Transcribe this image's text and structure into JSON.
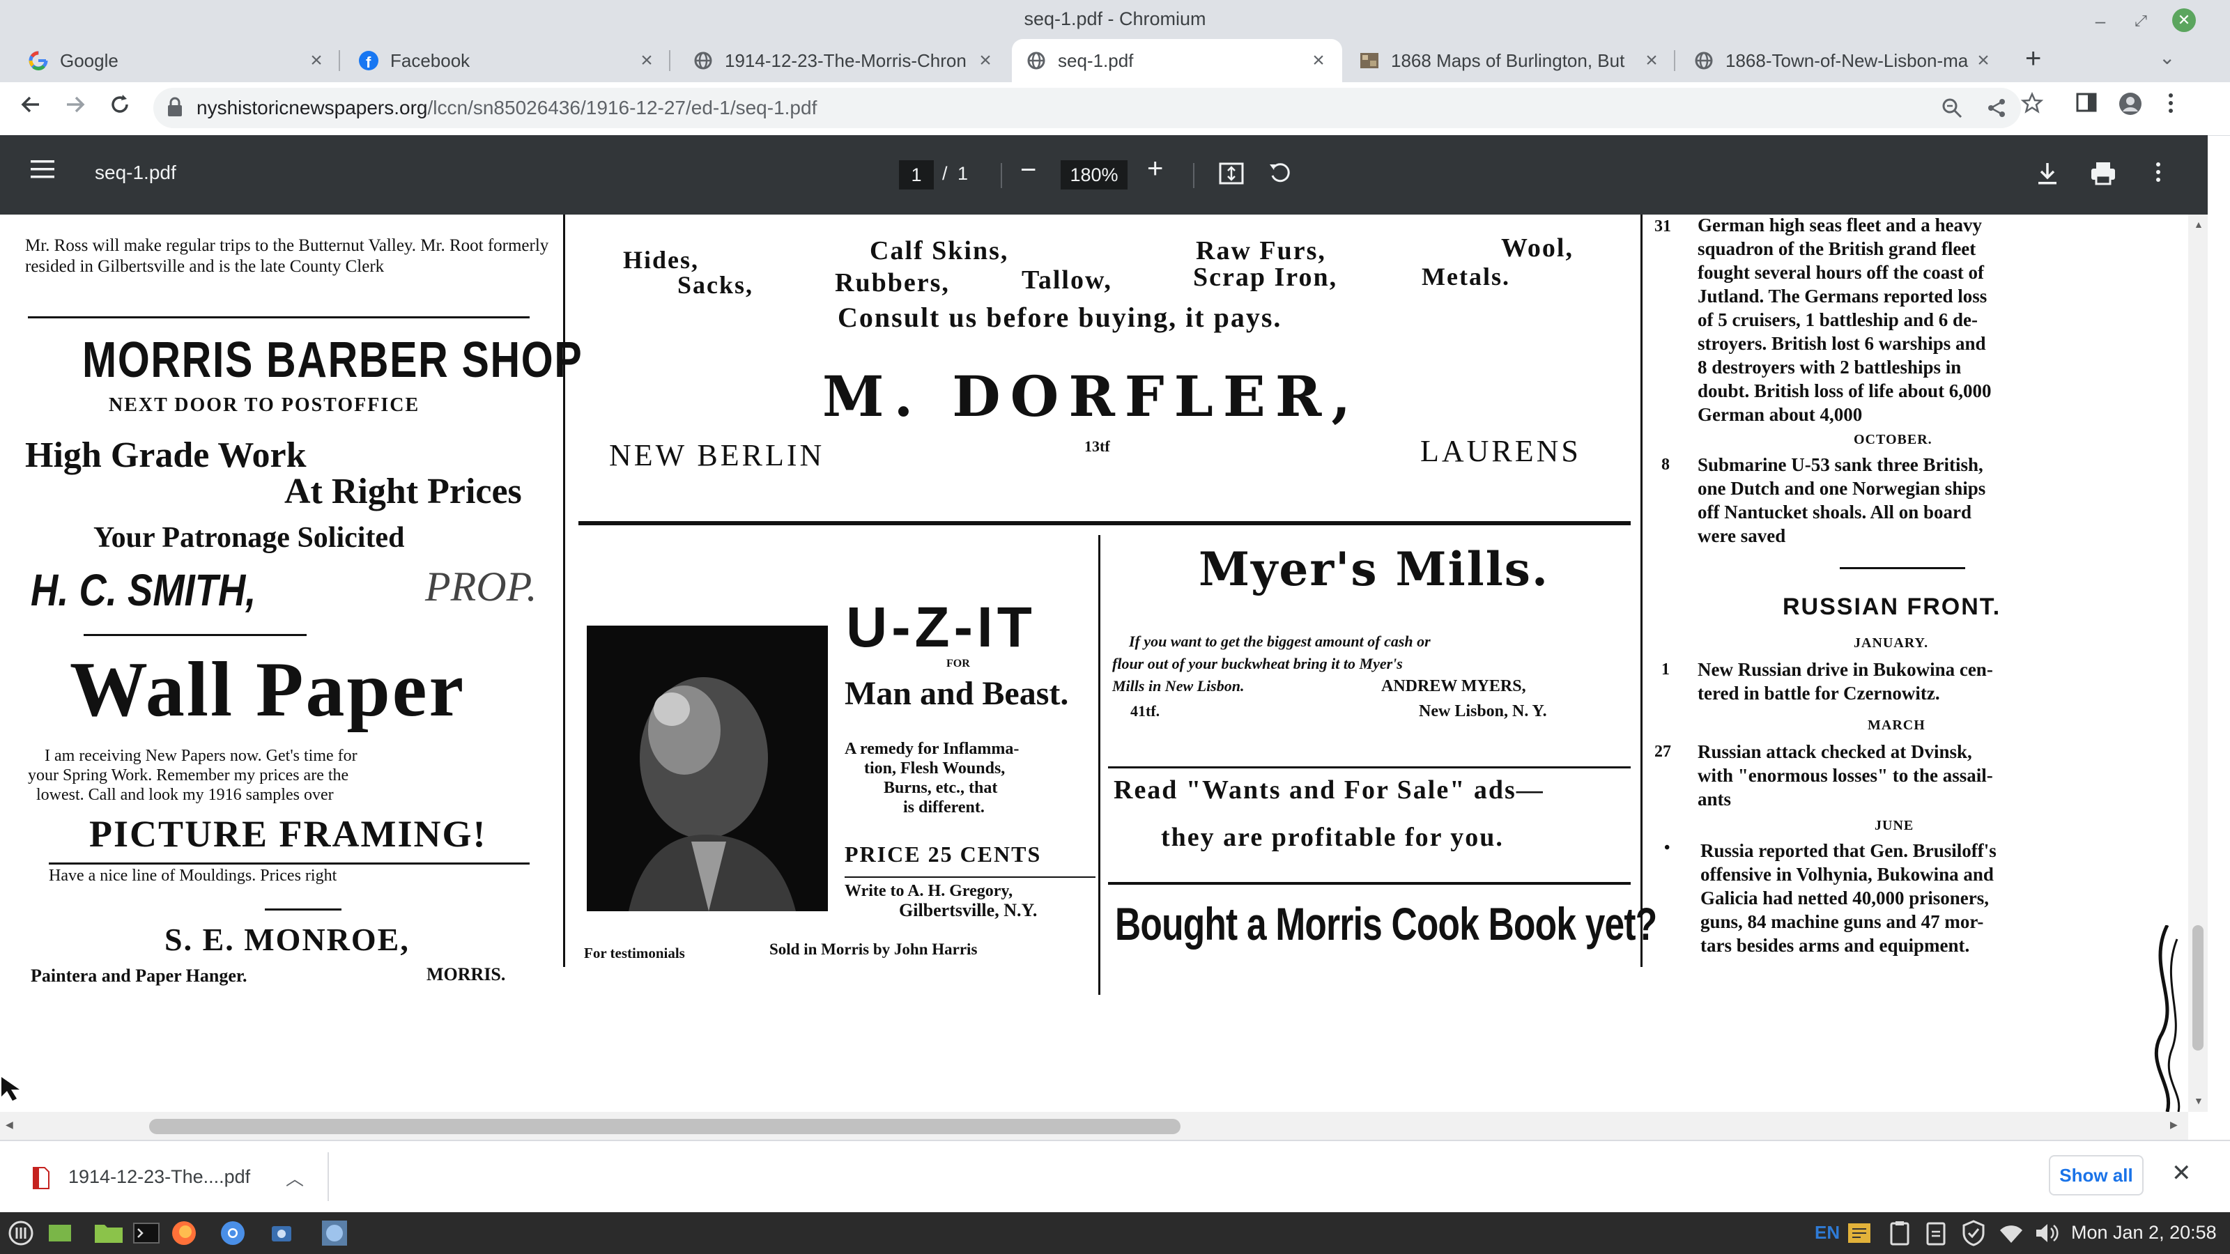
{
  "window": {
    "title": "seq-1.pdf - Chromium"
  },
  "tabs": [
    {
      "label": "Google",
      "icon": "google-icon",
      "active": false
    },
    {
      "label": "Facebook",
      "icon": "facebook-icon",
      "active": false
    },
    {
      "label": "1914-12-23-The-Morris-Chron",
      "icon": "globe-icon",
      "active": false
    },
    {
      "label": "seq-1.pdf",
      "icon": "globe-icon",
      "active": true
    },
    {
      "label": "1868 Maps of Burlington, But",
      "icon": "map-icon",
      "active": false
    },
    {
      "label": "1868-Town-of-New-Lisbon-ma",
      "icon": "globe-icon",
      "active": false
    }
  ],
  "omnibox": {
    "domain": "nyshistoricnewspapers.org",
    "path": "/lccn/sn85026436/1916-12-27/ed-1/seq-1.pdf"
  },
  "pdf_toolbar": {
    "title": "seq-1.pdf",
    "current_page": "1",
    "page_separator": "/",
    "total_pages": "1",
    "zoom": "180%",
    "zoom_out": "−",
    "zoom_in": "+"
  },
  "newspaper": {
    "col1": {
      "top_fragment": "Mr. Ross will make regular trips to the Butternut Valley. Mr. Root formerly resided in Gilbertsville and is the late County Clerk",
      "barber_title": "MORRIS BARBER SHOP",
      "barber_sub": "NEXT DOOR TO POSTOFFICE",
      "barber_l1": "High Grade Work",
      "barber_l2": "At Right Prices",
      "barber_l3": "Your Patronage Solicited",
      "barber_name": "H. C. SMITH,",
      "barber_prop": "PROP.",
      "wall_title": "Wall Paper",
      "wall_body_1": "I am receiving New Papers now. Get's time for",
      "wall_body_2": "your Spring Work. Remember my prices are the",
      "wall_body_3": "lowest. Call and look my 1916 samples over",
      "framing": "PICTURE FRAMING!",
      "framing_sub": "Have a nice line of Mouldings.     Prices right",
      "monroe": "S. E. MONROE,",
      "monroe_sub": "Paintera and Paper Hanger.",
      "monroe_town": "MORRIS."
    },
    "dorfler": {
      "row1": [
        "Hides,",
        "Calf Skins,",
        "Raw Furs,",
        "Wool,"
      ],
      "row2": [
        "Sacks,",
        "Rubbers,",
        "Tallow,",
        "Scrap Iron,",
        "Metals."
      ],
      "consult": "Consult us before buying, it pays.",
      "name": "M. DORFLER,",
      "left_town": "NEW BERLIN",
      "right_town": "LAURENS",
      "mid": "13tf"
    },
    "uzit": {
      "title": "U-Z-IT",
      "for": "FOR",
      "sub": "Man and Beast.",
      "desc_1": "A remedy for Inflamma-",
      "desc_2": "tion, Flesh Wounds,",
      "desc_3": "Burns, etc., that",
      "desc_4": "is different.",
      "price": "PRICE 25 CENTS",
      "write_1": "Write to A. H. Gregory,",
      "write_2": "Gilbertsville, N.Y.",
      "footer_left": "For testimonials",
      "footer_right": "Sold in Morris by John Harris"
    },
    "myers": {
      "title": "Myer's Mills.",
      "body_1": "If you want to get the biggest amount of cash or",
      "body_2": "flour out of your buckwheat bring it to Myer's",
      "body_3": "Mills in New Lisbon.",
      "signer": "ANDREW MYERS,",
      "tag": "41tf.",
      "place": "New Lisbon, N. Y.",
      "wants_1": "Read \"Wants and For Sale\" ads—",
      "wants_2": "they are profitable for you.",
      "cookbook": "Bought a Morris Cook Book yet?"
    },
    "col4": {
      "n31": "31",
      "war_1": "German high seas fleet and a heavy",
      "war_2": "squadron of the British grand fleet",
      "war_3": "fought several hours off the coast of",
      "war_4": "Jutland. The Germans reported loss",
      "war_5": "of 5 cruisers, 1 battleship and 6 de-",
      "war_6": "stroyers. British lost 6 warships and",
      "war_7": "8 destroyers with 2 battleships in",
      "war_8": "doubt. British loss of life about 6,000",
      "war_9": "German about 4,000",
      "october": "OCTOBER.",
      "n8": "8",
      "sub_1": "Submarine U-53 sank three British,",
      "sub_2": "one Dutch and one Norwegian ships",
      "sub_3": "off Nantucket shoals. All on board",
      "sub_4": "were saved",
      "russian": "RUSSIAN FRONT.",
      "january": "JANUARY.",
      "n1": "1",
      "jan_1": "New Russian drive in Bukowina cen-",
      "jan_2": "tered in battle for Czernowitz.",
      "march": "MARCH",
      "n27": "27",
      "mar_1": "Russian attack checked at Dvinsk,",
      "mar_2": "with \"enormous losses\" to the assail-",
      "mar_3": "ants",
      "june": "JUNE",
      "bullet": "•",
      "jun_1": "Russia reported that Gen. Brusiloff's",
      "jun_2": "offensive in Volhynia, Bukowina and",
      "jun_3": "Galicia had netted 40,000 prisoners,",
      "jun_4": "guns, 84 machine guns and 47 mor-",
      "jun_5": "tars besides arms and equipment."
    }
  },
  "downloads": {
    "item_name": "1914-12-23-The....pdf",
    "show_all": "Show all"
  },
  "taskbar": {
    "lang": "EN",
    "clock": "Mon Jan  2, 20:58"
  }
}
